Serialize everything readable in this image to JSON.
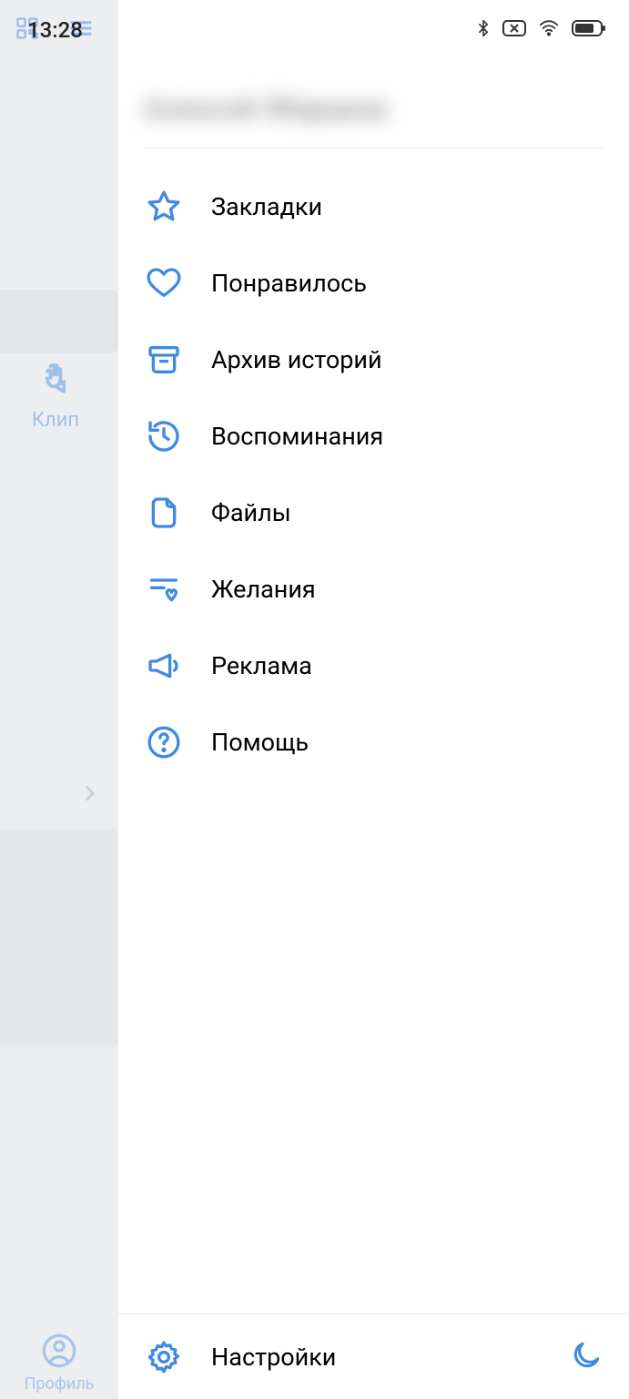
{
  "statusbar": {
    "time": "13:28"
  },
  "left": {
    "clip_label": "Клип",
    "profile_label": "Профиль"
  },
  "header": {
    "user_name": "Алексей Фёдоров"
  },
  "menu": {
    "bookmarks": "Закладки",
    "liked": "Понравилось",
    "story_archive": "Архив историй",
    "memories": "Воспоминания",
    "files": "Файлы",
    "wishes": "Желания",
    "ads": "Реклама",
    "help": "Помощь"
  },
  "footer": {
    "settings": "Настройки"
  }
}
